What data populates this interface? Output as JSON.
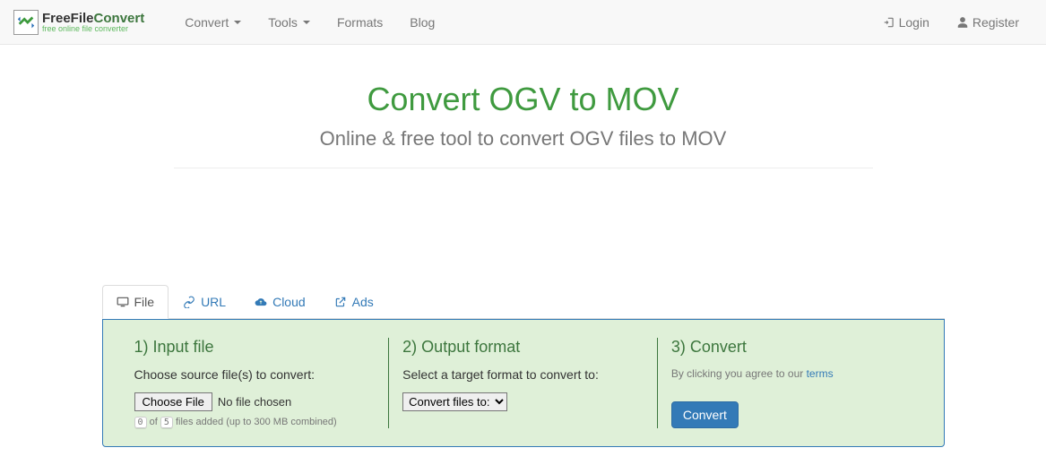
{
  "nav": {
    "brand_main1": "FreeFile",
    "brand_main2": "Convert",
    "brand_sub": "free online file converter",
    "items": [
      {
        "label": "Convert",
        "dropdown": true
      },
      {
        "label": "Tools",
        "dropdown": true
      },
      {
        "label": "Formats",
        "dropdown": false
      },
      {
        "label": "Blog",
        "dropdown": false
      }
    ],
    "login": "Login",
    "register": "Register"
  },
  "header": {
    "title": "Convert OGV to MOV",
    "subtitle": "Online & free tool to convert OGV files to MOV"
  },
  "tabs": {
    "file": "File",
    "url": "URL",
    "cloud": "Cloud",
    "ads": "Ads"
  },
  "step1": {
    "title": "1) Input file",
    "desc": "Choose source file(s) to convert:",
    "choose_btn": "Choose File",
    "no_file": "No file chosen",
    "files_added": "0",
    "files_max": "5",
    "of": "of",
    "files_text": "files added (up to 300 MB combined)"
  },
  "step2": {
    "title": "2) Output format",
    "desc": "Select a target format to convert to:",
    "select_label": "Convert files to:"
  },
  "step3": {
    "title": "3) Convert",
    "agree_prefix": "By clicking you agree to our ",
    "terms": "terms",
    "convert_btn": "Convert"
  }
}
